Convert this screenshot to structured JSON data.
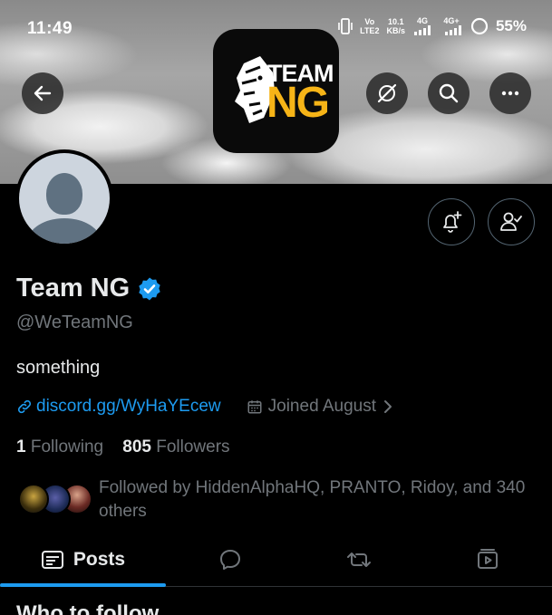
{
  "status_bar": {
    "time": "11:49",
    "net_top": "Vo",
    "net_bottom": "LTE2",
    "speed_top": "10.1",
    "speed_bottom": "KB/s",
    "sig1": "4G",
    "sig2": "4G+",
    "battery": "55%"
  },
  "header": {
    "back_icon": "arrow-left-icon",
    "icons": [
      "grok-slash-icon",
      "search-icon",
      "more-icon"
    ]
  },
  "logo": {
    "line1": "TEAM",
    "line2": "NG",
    "accent": "#f6b417"
  },
  "profile": {
    "name": "Team NG",
    "verified_color": "#1d9bf0",
    "handle": "@WeTeamNG",
    "bio": "something",
    "link": "discord.gg/WyHaYEcew",
    "joined": "Joined August",
    "following_count": "1",
    "following_label": "Following",
    "followers_count": "805",
    "followers_label": "Followers",
    "followed_by": "Followed by HiddenAlphaHQ, PRANTO, Ridoy, and 340 others"
  },
  "tabs": [
    {
      "label": "Posts",
      "icon": "posts-icon"
    },
    {
      "label": "",
      "icon": "reply-icon"
    },
    {
      "label": "",
      "icon": "repost-icon"
    },
    {
      "label": "",
      "icon": "media-icon"
    }
  ],
  "section_title": "Who to follow"
}
